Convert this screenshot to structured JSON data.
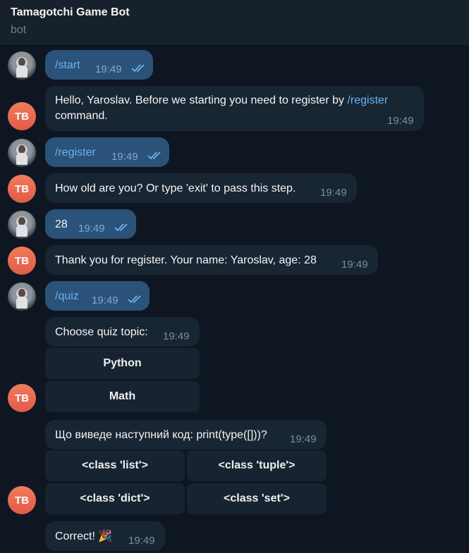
{
  "header": {
    "title": "Tamagotchi Game Bot",
    "subtitle": "bot"
  },
  "bot_avatar_initials": "TB",
  "messages": [
    {
      "text": "/start",
      "time": "19:49"
    },
    {
      "text_before": "Hello, Yaroslav. Before we starting you need to register by ",
      "cmd": "/register",
      "text_after": "command.",
      "time": "19:49"
    },
    {
      "text": "/register",
      "time": "19:49"
    },
    {
      "text": "How old are you? Or type 'exit' to pass this step.",
      "time": "19:49"
    },
    {
      "text": "28",
      "time": "19:49"
    },
    {
      "text": "Thank you for register. Your name: Yaroslav, age: 28",
      "time": "19:49"
    },
    {
      "text": "/quiz",
      "time": "19:49"
    },
    {
      "text": "Choose quiz topic:",
      "time": "19:49",
      "buttons": [
        "Python",
        "Math"
      ]
    },
    {
      "text": "Що виведе наступний код: print(type([]))?",
      "time": "19:49",
      "buttons": [
        "<class 'list'>",
        "<class 'tuple'>",
        "<class 'dict'>",
        "<class 'set'>"
      ]
    },
    {
      "text": "Correct! 🎉",
      "time": "19:49"
    }
  ],
  "colors": {
    "background": "#0e1621",
    "outgoing": "#2b5278",
    "incoming": "#182533",
    "link": "#6ab3f3",
    "avatar": "#e8634f"
  }
}
